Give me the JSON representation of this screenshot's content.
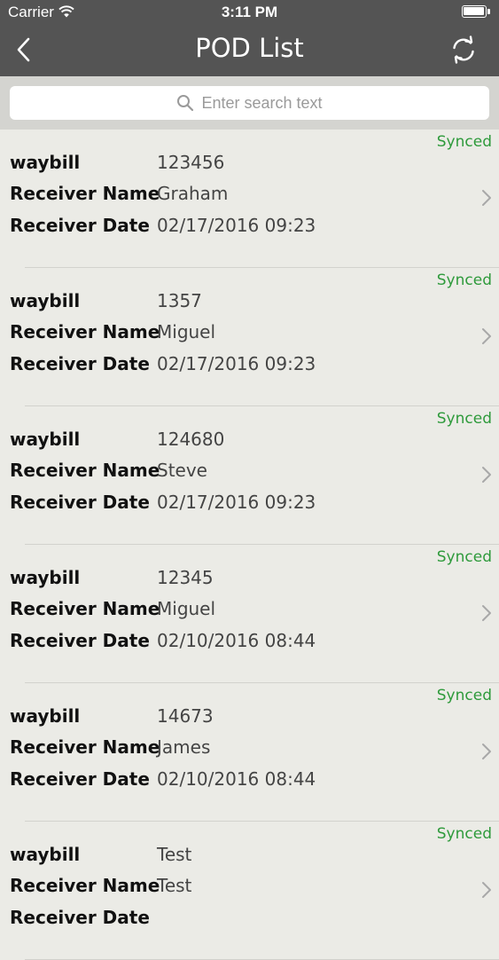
{
  "status_bar": {
    "carrier": "Carrier",
    "time": "3:11 PM"
  },
  "nav": {
    "title": "POD List",
    "back_icon": "back-chevron-icon",
    "refresh_icon": "refresh-icon"
  },
  "search": {
    "placeholder": "Enter search text",
    "icon": "search-icon"
  },
  "colors": {
    "nav_background": "#545454",
    "search_background": "#d4d4d0",
    "list_background": "#ebebe6",
    "synced_green": "#2e9a3b"
  },
  "field_labels": {
    "waybill": "waybill",
    "receiver_name": "Receiver Name",
    "receiver_date": "Receiver Date"
  },
  "records": [
    {
      "status": "Synced",
      "waybill": "123456",
      "receiver_name": "Graham",
      "receiver_date": "02/17/2016 09:23"
    },
    {
      "status": "Synced",
      "waybill": "1357",
      "receiver_name": "Miguel",
      "receiver_date": "02/17/2016 09:23"
    },
    {
      "status": "Synced",
      "waybill": "124680",
      "receiver_name": "Steve",
      "receiver_date": "02/17/2016 09:23"
    },
    {
      "status": "Synced",
      "waybill": "12345",
      "receiver_name": "Miguel",
      "receiver_date": "02/10/2016 08:44"
    },
    {
      "status": "Synced",
      "waybill": "14673",
      "receiver_name": "James",
      "receiver_date": "02/10/2016 08:44"
    },
    {
      "status": "Synced",
      "waybill": "Test",
      "receiver_name": "Test",
      "receiver_date": ""
    }
  ]
}
